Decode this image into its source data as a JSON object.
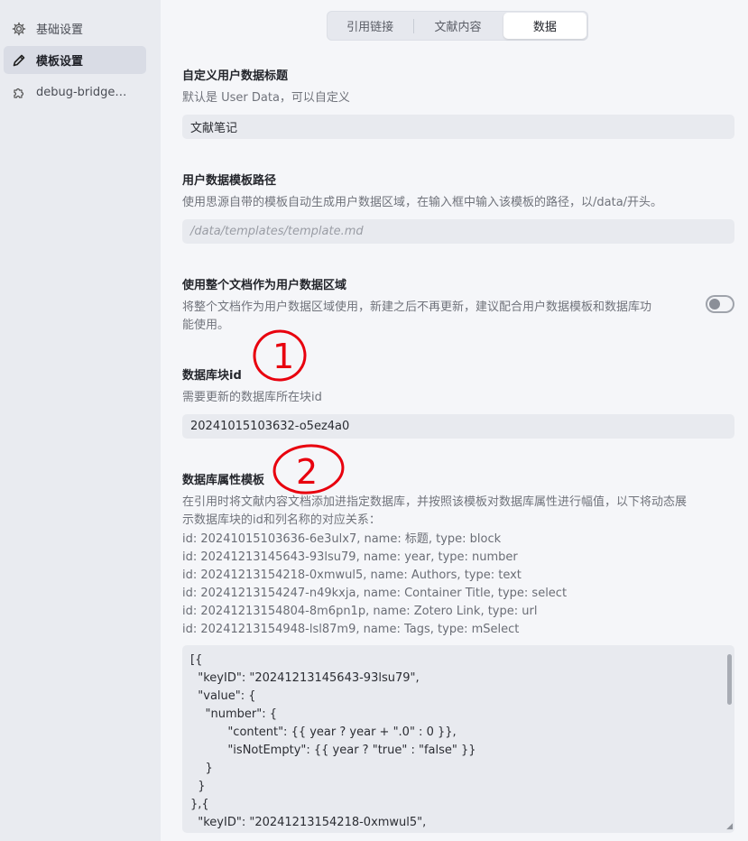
{
  "sidebar": {
    "items": [
      {
        "label": "基础设置",
        "icon": "gear-icon"
      },
      {
        "label": "模板设置",
        "icon": "pencil-icon"
      },
      {
        "label": "debug-bridge…",
        "icon": "puzzle-icon"
      }
    ]
  },
  "tabs": [
    {
      "label": "引用链接"
    },
    {
      "label": "文献内容"
    },
    {
      "label": "数据"
    }
  ],
  "sections": {
    "custom_title": {
      "title": "自定义用户数据标题",
      "desc": "默认是 User Data，可以自定义",
      "value": "文献笔记"
    },
    "template_path": {
      "title": "用户数据模板路径",
      "desc": "使用思源自带的模板自动生成用户数据区域，在输入框中输入该模板的路径，以/data/开头。",
      "placeholder": "/data/templates/template.md"
    },
    "whole_doc": {
      "title": "使用整个文档作为用户数据区域",
      "desc_line1": "将整个文档作为用户数据区域使用，新建之后不再更新，建议配合用户数据模板和数据库功",
      "desc_line2": "能使用。",
      "enabled": false
    },
    "db_block": {
      "title": "数据库块id",
      "desc": "需要更新的数据库所在块id",
      "value": "20241015103632-o5ez4a0"
    },
    "db_attr_template": {
      "title": "数据库属性模板",
      "desc_line1": "在引用时将文献内容文档添加进指定数据库，并按照该模板对数据库属性进行幅值，以下将动态展",
      "desc_line2": "示数据库块的id和列名称的对应关系：",
      "columns": [
        "id: 20241015103636-6e3ulx7, name: 标题, type: block",
        "id: 20241213145643-93lsu79, name: year, type: number",
        "id: 20241213154218-0xmwul5, name: Authors, type: text",
        "id: 20241213154247-n49kxja, name: Container Title, type: select",
        "id: 20241213154804-8m6pn1p, name: Zotero Link, type: url",
        "id: 20241213154948-lsl87m9, name: Tags, type: mSelect"
      ],
      "code": "[{\n  \"keyID\": \"20241213145643-93lsu79\",\n  \"value\": {\n    \"number\": {\n          \"content\": {{ year ? year + \".0\" : 0 }},\n          \"isNotEmpty\": {{ year ? \"true\" : \"false\" }}\n    }\n  }\n},{\n  \"keyID\": \"20241213154218-0xmwul5\","
    }
  },
  "annotations": [
    "1",
    "2"
  ],
  "colors": {
    "annotation": "#e8000e",
    "toggle_off": "#8b8f98"
  }
}
